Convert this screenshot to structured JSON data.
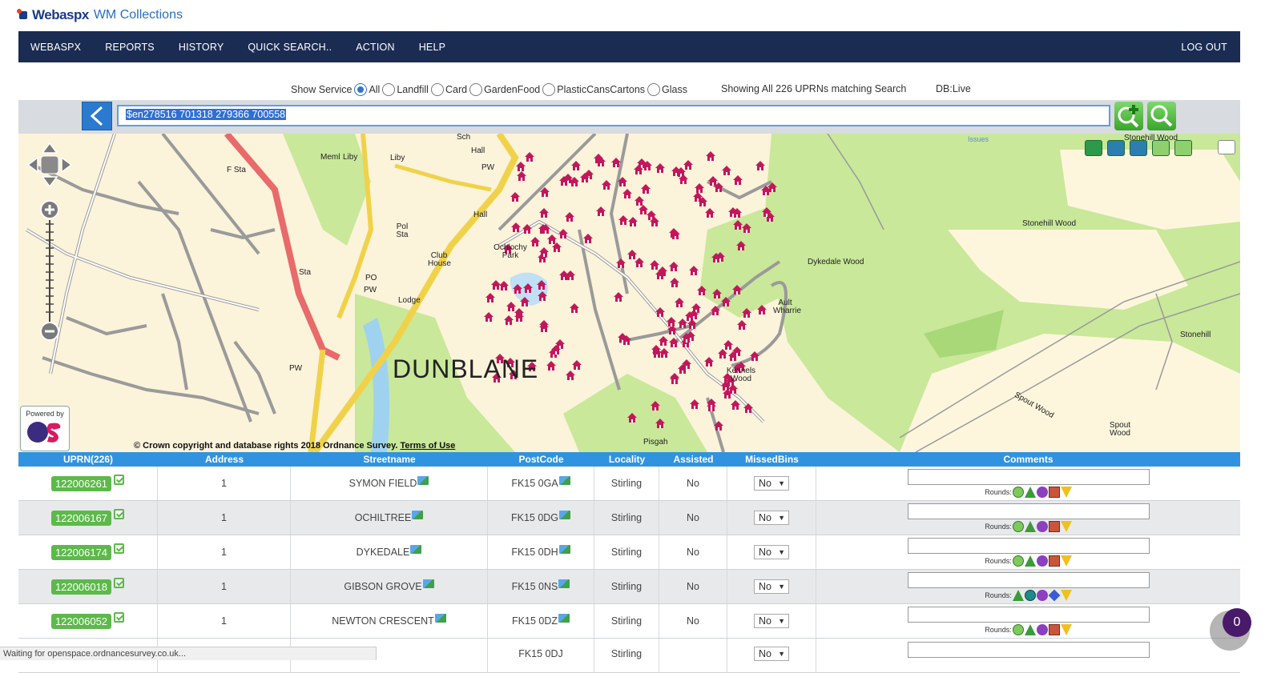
{
  "brand": {
    "name": "Webaspx",
    "subtitle": "WM Collections"
  },
  "nav": {
    "items": [
      "WEBASPX",
      "REPORTS",
      "HISTORY",
      "QUICK SEARCH..",
      "ACTION",
      "HELP"
    ],
    "logout": "LOG OUT"
  },
  "service": {
    "label": "Show Service",
    "options": [
      "All",
      "Landfill",
      "Card",
      "GardenFood",
      "PlasticCansCartons",
      "Glass"
    ],
    "selected": "All"
  },
  "showing": "Showing All 226 UPRNs matching Search",
  "db": "DB:Live",
  "search": {
    "value": "$en278516 701318 279366 700558"
  },
  "map": {
    "town_label": "DUNBLANE",
    "copyright_prefix": "© Crown copyright and database rights 2018 Ordnance Survey. ",
    "copyright_link": "Terms of Use",
    "powered_by": "Powered by",
    "labels": {
      "stonehill_wood": "Stonehill Wood",
      "dykedale_wood": "Dykedale Wood",
      "ault_wharrie": "Ault Wharrie",
      "stonehill": "Stonehill",
      "kennels_wood": "Kennels Wood",
      "spout_wood": "Spout Wood",
      "spout_wood2": "Spout Wood",
      "ochlochy_park": "Ochlochy Park",
      "club_house": "Club House",
      "lodge": "Lodge",
      "pisgah": "Pisgah",
      "hall": "Hall",
      "hall2": "Hall",
      "memi": "Meml",
      "liby": "Liby",
      "liby2": "Liby",
      "sch": "Sch",
      "pw": "PW",
      "pw2": "PW",
      "pw3": "PW",
      "pol_sta": "Pol Sta",
      "sta": "Sta",
      "f_sta": "F Sta",
      "po": "PO",
      "issues": "Issues",
      "stonehill_wood_top": "Stonehill Wood"
    }
  },
  "grid": {
    "headers": [
      "UPRN(226)",
      "Address",
      "Streetname",
      "PostCode",
      "Locality",
      "Assisted",
      "MissedBins",
      "Comments"
    ],
    "rounds_label": "Rounds:",
    "rows": [
      {
        "uprn": "122006261",
        "address": "1",
        "street": "SYMON FIELD",
        "postcode": "FK15 0GA",
        "locality": "Stirling",
        "assisted": "No",
        "missed": "No"
      },
      {
        "uprn": "122006167",
        "address": "1",
        "street": "OCHILTREE",
        "postcode": "FK15 0DG",
        "locality": "Stirling",
        "assisted": "No",
        "missed": "No"
      },
      {
        "uprn": "122006174",
        "address": "1",
        "street": "DYKEDALE",
        "postcode": "FK15 0DH",
        "locality": "Stirling",
        "assisted": "No",
        "missed": "No"
      },
      {
        "uprn": "122006018",
        "address": "1",
        "street": "GIBSON GROVE",
        "postcode": "FK15 0NS",
        "locality": "Stirling",
        "assisted": "No",
        "missed": "No"
      },
      {
        "uprn": "122006052",
        "address": "1",
        "street": "NEWTON CRESCENT",
        "postcode": "FK15 0DZ",
        "locality": "Stirling",
        "assisted": "No",
        "missed": "No"
      }
    ],
    "partial_row": {
      "postcode": "FK15 0DJ",
      "locality": "Stirling",
      "missed": "No"
    }
  },
  "status": "Waiting for openspace.ordnancesurvey.co.uk...",
  "notification_count": "0",
  "colors": {
    "nav": "#1b2c53",
    "header": "#3193e0",
    "uprn_badge": "#5db94a",
    "house": "#c2185b"
  }
}
